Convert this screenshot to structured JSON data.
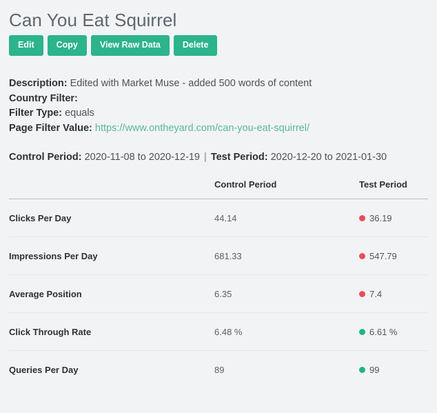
{
  "header": {
    "title": "Can You Eat Squirrel",
    "buttons": [
      {
        "label": "Edit",
        "name": "edit-button"
      },
      {
        "label": "Copy",
        "name": "copy-button"
      },
      {
        "label": "View Raw Data",
        "name": "view-raw-data-button"
      },
      {
        "label": "Delete",
        "name": "delete-button"
      }
    ]
  },
  "meta": {
    "description_label": "Description:",
    "description_value": "Edited with Market Muse - added 500 words of content",
    "country_filter_label": "Country Filter:",
    "country_filter_value": "",
    "filter_type_label": "Filter Type:",
    "filter_type_value": "equals",
    "page_filter_label": "Page Filter Value:",
    "page_filter_value": "https://www.ontheyard.com/can-you-eat-squirrel/"
  },
  "periods": {
    "control_label": "Control Period:",
    "control_value": "2020-11-08 to 2020-12-19",
    "separator": "|",
    "test_label": "Test Period:",
    "test_value": "2020-12-20 to 2021-01-30"
  },
  "table": {
    "columns": [
      "",
      "Control Period",
      "Test Period"
    ],
    "rows": [
      {
        "metric": "Clicks Per Day",
        "control": "44.14",
        "test": "36.19",
        "trend": "down"
      },
      {
        "metric": "Impressions Per Day",
        "control": "681.33",
        "test": "547.79",
        "trend": "down"
      },
      {
        "metric": "Average Position",
        "control": "6.35",
        "test": "7.4",
        "trend": "down"
      },
      {
        "metric": "Click Through Rate",
        "control": "6.48 %",
        "test": "6.61 %",
        "trend": "up"
      },
      {
        "metric": "Queries Per Day",
        "control": "89",
        "test": "99",
        "trend": "up"
      }
    ]
  },
  "colors": {
    "accent_green": "#2cb48c",
    "link_teal": "#59b79f",
    "trend_down": "#ea4c5d",
    "trend_up": "#1fb48a",
    "background": "#f2f3f4",
    "title": "#5d6771"
  }
}
